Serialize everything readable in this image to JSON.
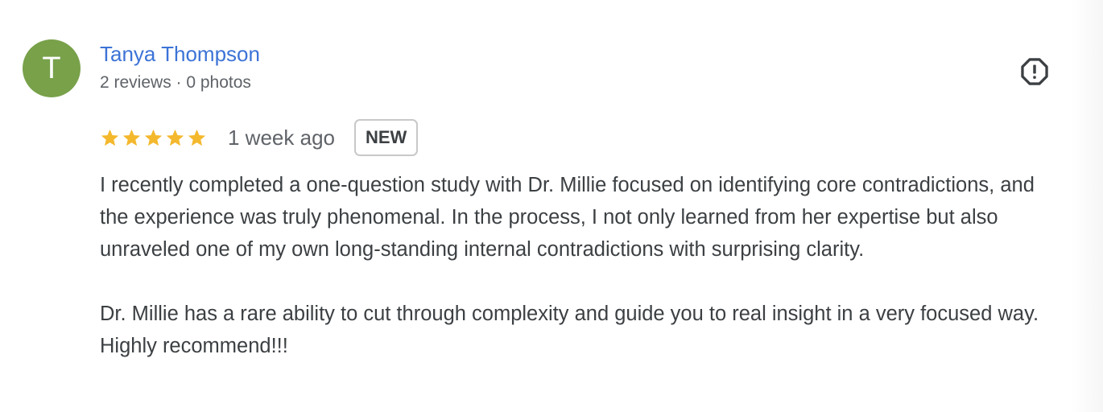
{
  "review": {
    "avatar_initial": "T",
    "avatar_color": "#78a14a",
    "author_name": "Tanya Thompson",
    "author_meta": "2 reviews · 0 photos",
    "rating": 5,
    "rating_max": 5,
    "star_color": "#f4b82d",
    "time_ago": "1 week ago",
    "badge": "NEW",
    "report_icon": "report-flag-icon",
    "paragraphs": [
      "I recently completed a one-question study with Dr. Millie focused on identifying core contradictions, and the experience was truly phenomenal. In the process, I not only learned from her expertise but also unraveled one of my own long-standing internal contradictions with surprising clarity.",
      "Dr. Millie has a rare ability to cut through complexity and guide you to real insight in a very focused way. Highly recommend!!!"
    ]
  },
  "colors": {
    "author_link": "#3c73d6",
    "secondary_text": "#5f6368",
    "body_text": "#3c4043"
  }
}
